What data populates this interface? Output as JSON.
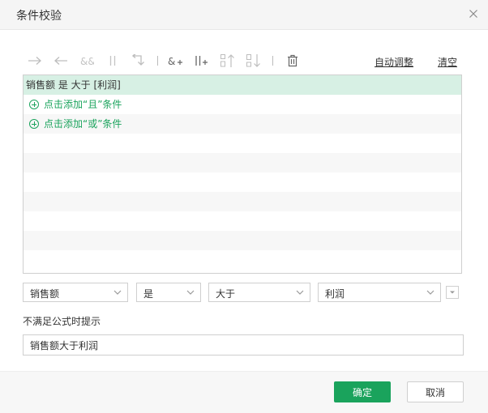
{
  "dialog": {
    "title": "条件校验"
  },
  "toolbar": {
    "auto_adjust_label": "自动调整",
    "clear_label": "清空",
    "icons": [
      "arrow-right-icon",
      "arrow-left-icon",
      "and-icon",
      "or-icon",
      "return-icon",
      "add-and-icon",
      "add-or-icon",
      "move-up-icon",
      "move-down-icon",
      "delete-icon"
    ]
  },
  "conditions": {
    "rows": [
      {
        "text": "销售额 是 大于 [利润]",
        "selected": true
      },
      {
        "text": "点击添加“且”条件",
        "type": "add"
      },
      {
        "text": "点击添加“或”条件",
        "type": "add"
      }
    ]
  },
  "editor": {
    "field_value": "销售额",
    "relation_value": "是",
    "operator_value": "大于",
    "target_value": "利润"
  },
  "tip": {
    "label": "不满足公式时提示",
    "value": "销售额大于利润"
  },
  "footer": {
    "ok_label": "确定",
    "cancel_label": "取消"
  },
  "colors": {
    "accent": "#1aa35c",
    "selected_row": "#d7f0e4"
  }
}
